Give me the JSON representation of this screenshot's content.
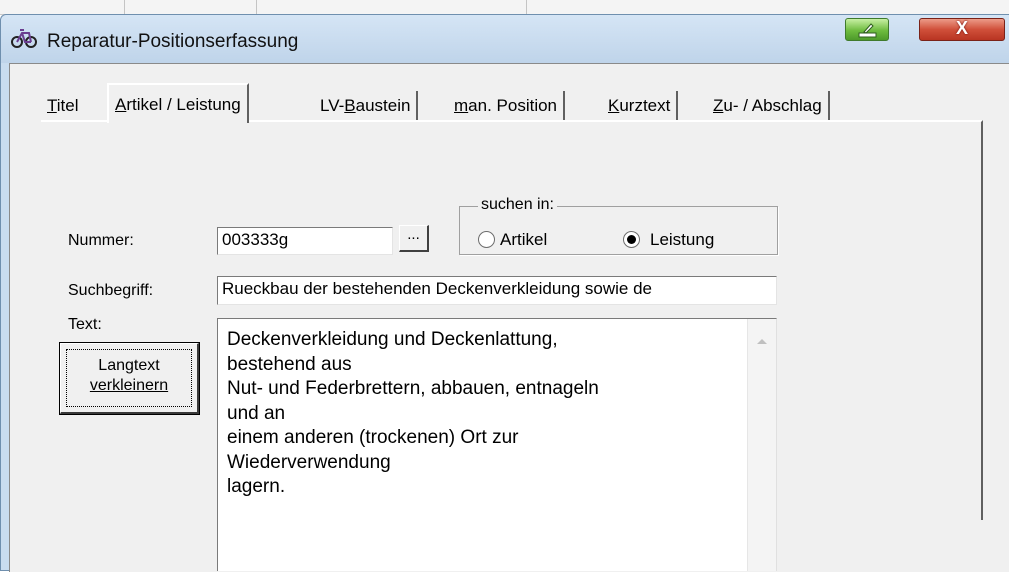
{
  "window": {
    "title": "Reparatur-Positionserfassung",
    "close_glyph": "X",
    "icons": {
      "app": "bicycle-icon",
      "minimize": "minimize-icon",
      "close": "close-icon"
    }
  },
  "tabs": [
    {
      "access_key": "T",
      "rest": "itel"
    },
    {
      "access_key": "A",
      "rest": "rtikel / Leistung"
    },
    {
      "pre": "LV-",
      "access_key": "B",
      "rest": "austein"
    },
    {
      "access_key": "m",
      "rest": "an. Position"
    },
    {
      "access_key": "K",
      "rest": "urztext"
    },
    {
      "access_key": "Z",
      "rest": "u- / Abschlag"
    }
  ],
  "form": {
    "nummer_label": "Nummer:",
    "nummer_value": "003333g",
    "browse_label": "...",
    "suchbegriff_label": "Suchbegriff:",
    "suchbegriff_value": "Rueckbau der bestehenden Deckenverkleidung sowie de",
    "text_label": "Text:",
    "langtext_button": {
      "line1": "Langtext",
      "line2": "verkleinern"
    },
    "search_group": {
      "legend": "suchen in:",
      "option_artikel": "Artikel",
      "option_leistung": "Leistung",
      "selected": "Leistung"
    },
    "text_lines": [
      "Deckenverkleidung und Deckenlattung,",
      "bestehend aus",
      "Nut- und Federbrettern, abbauen, entnageln",
      "und an",
      "einem anderen (trockenen) Ort zur",
      "Wiederverwendung",
      "lagern."
    ]
  }
}
